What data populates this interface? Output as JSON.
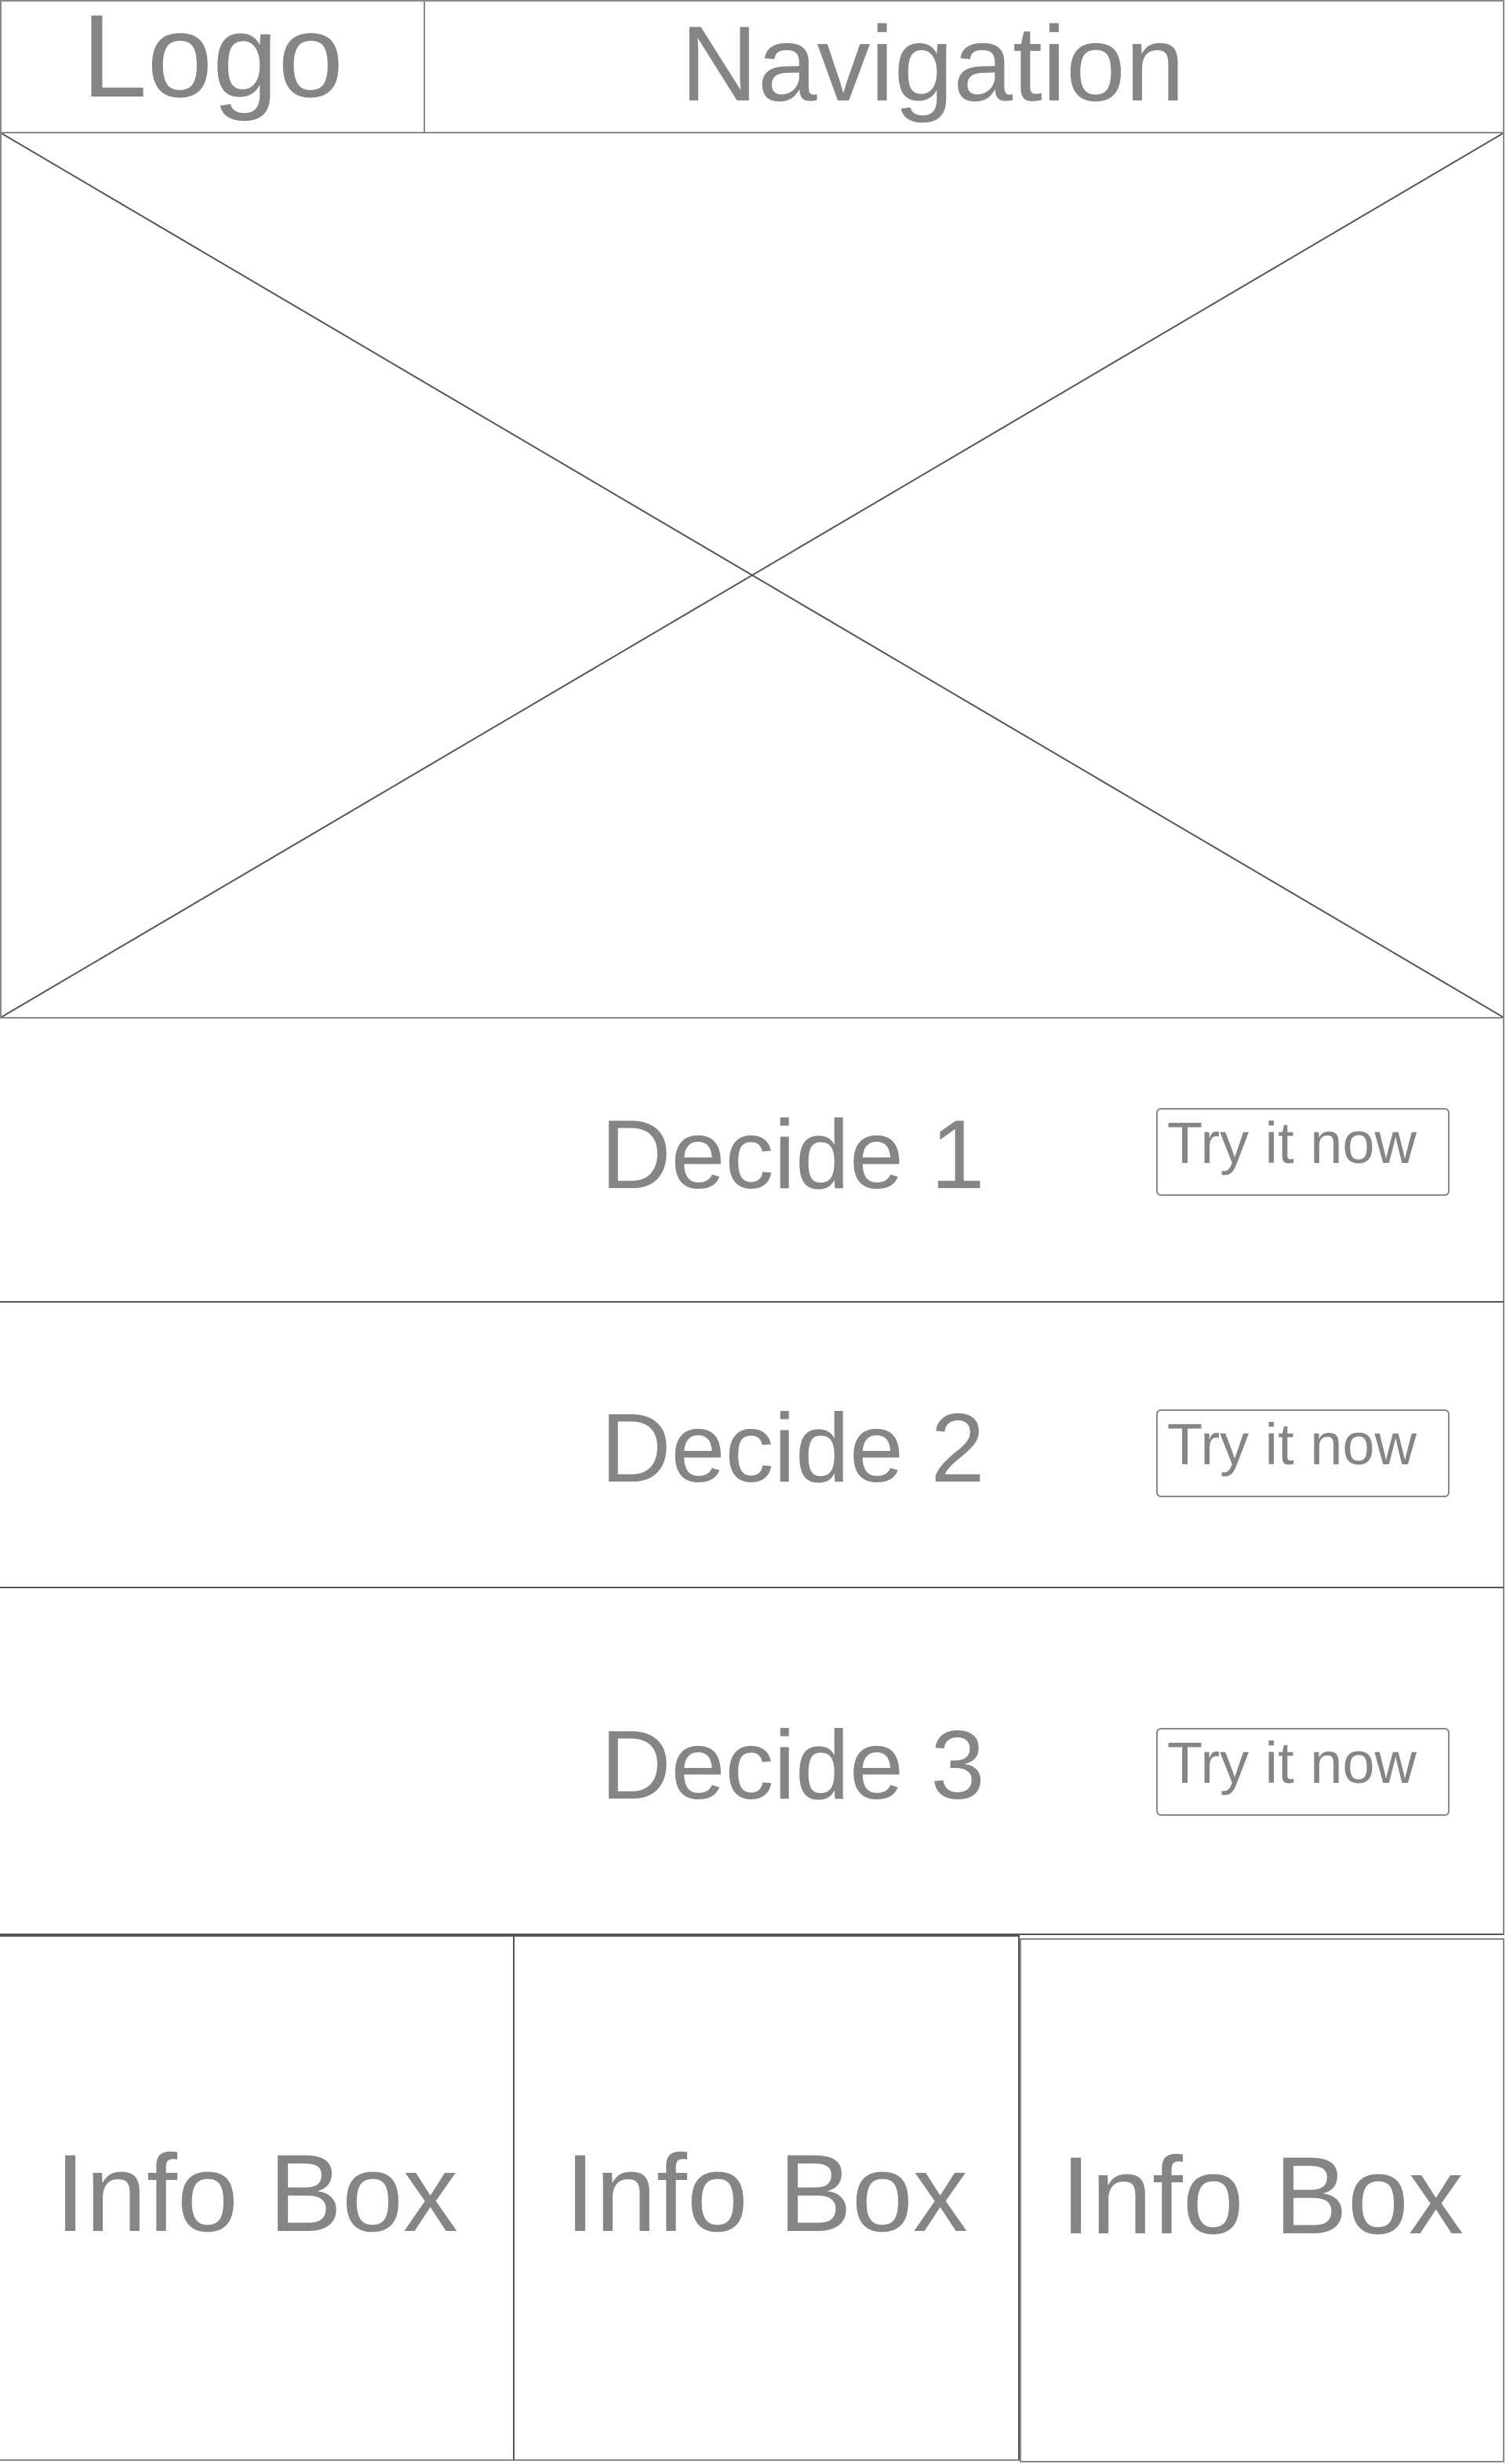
{
  "header": {
    "logo_label": "Logo",
    "navigation_label": "Navigation"
  },
  "decide_rows": [
    {
      "label": "Decide 1",
      "button_label": "Try it now"
    },
    {
      "label": "Decide 2",
      "button_label": "Try it now"
    },
    {
      "label": "Decide 3",
      "button_label": "Try it now"
    }
  ],
  "info_boxes": [
    {
      "label": "Info Box"
    },
    {
      "label": "Info Box"
    },
    {
      "label": "Info Box"
    }
  ],
  "colors": {
    "text": "#858585",
    "border": "#8a8a8a",
    "divider": "#555555",
    "background": "#ffffff"
  },
  "icons": {
    "hero": "image-placeholder-icon"
  }
}
